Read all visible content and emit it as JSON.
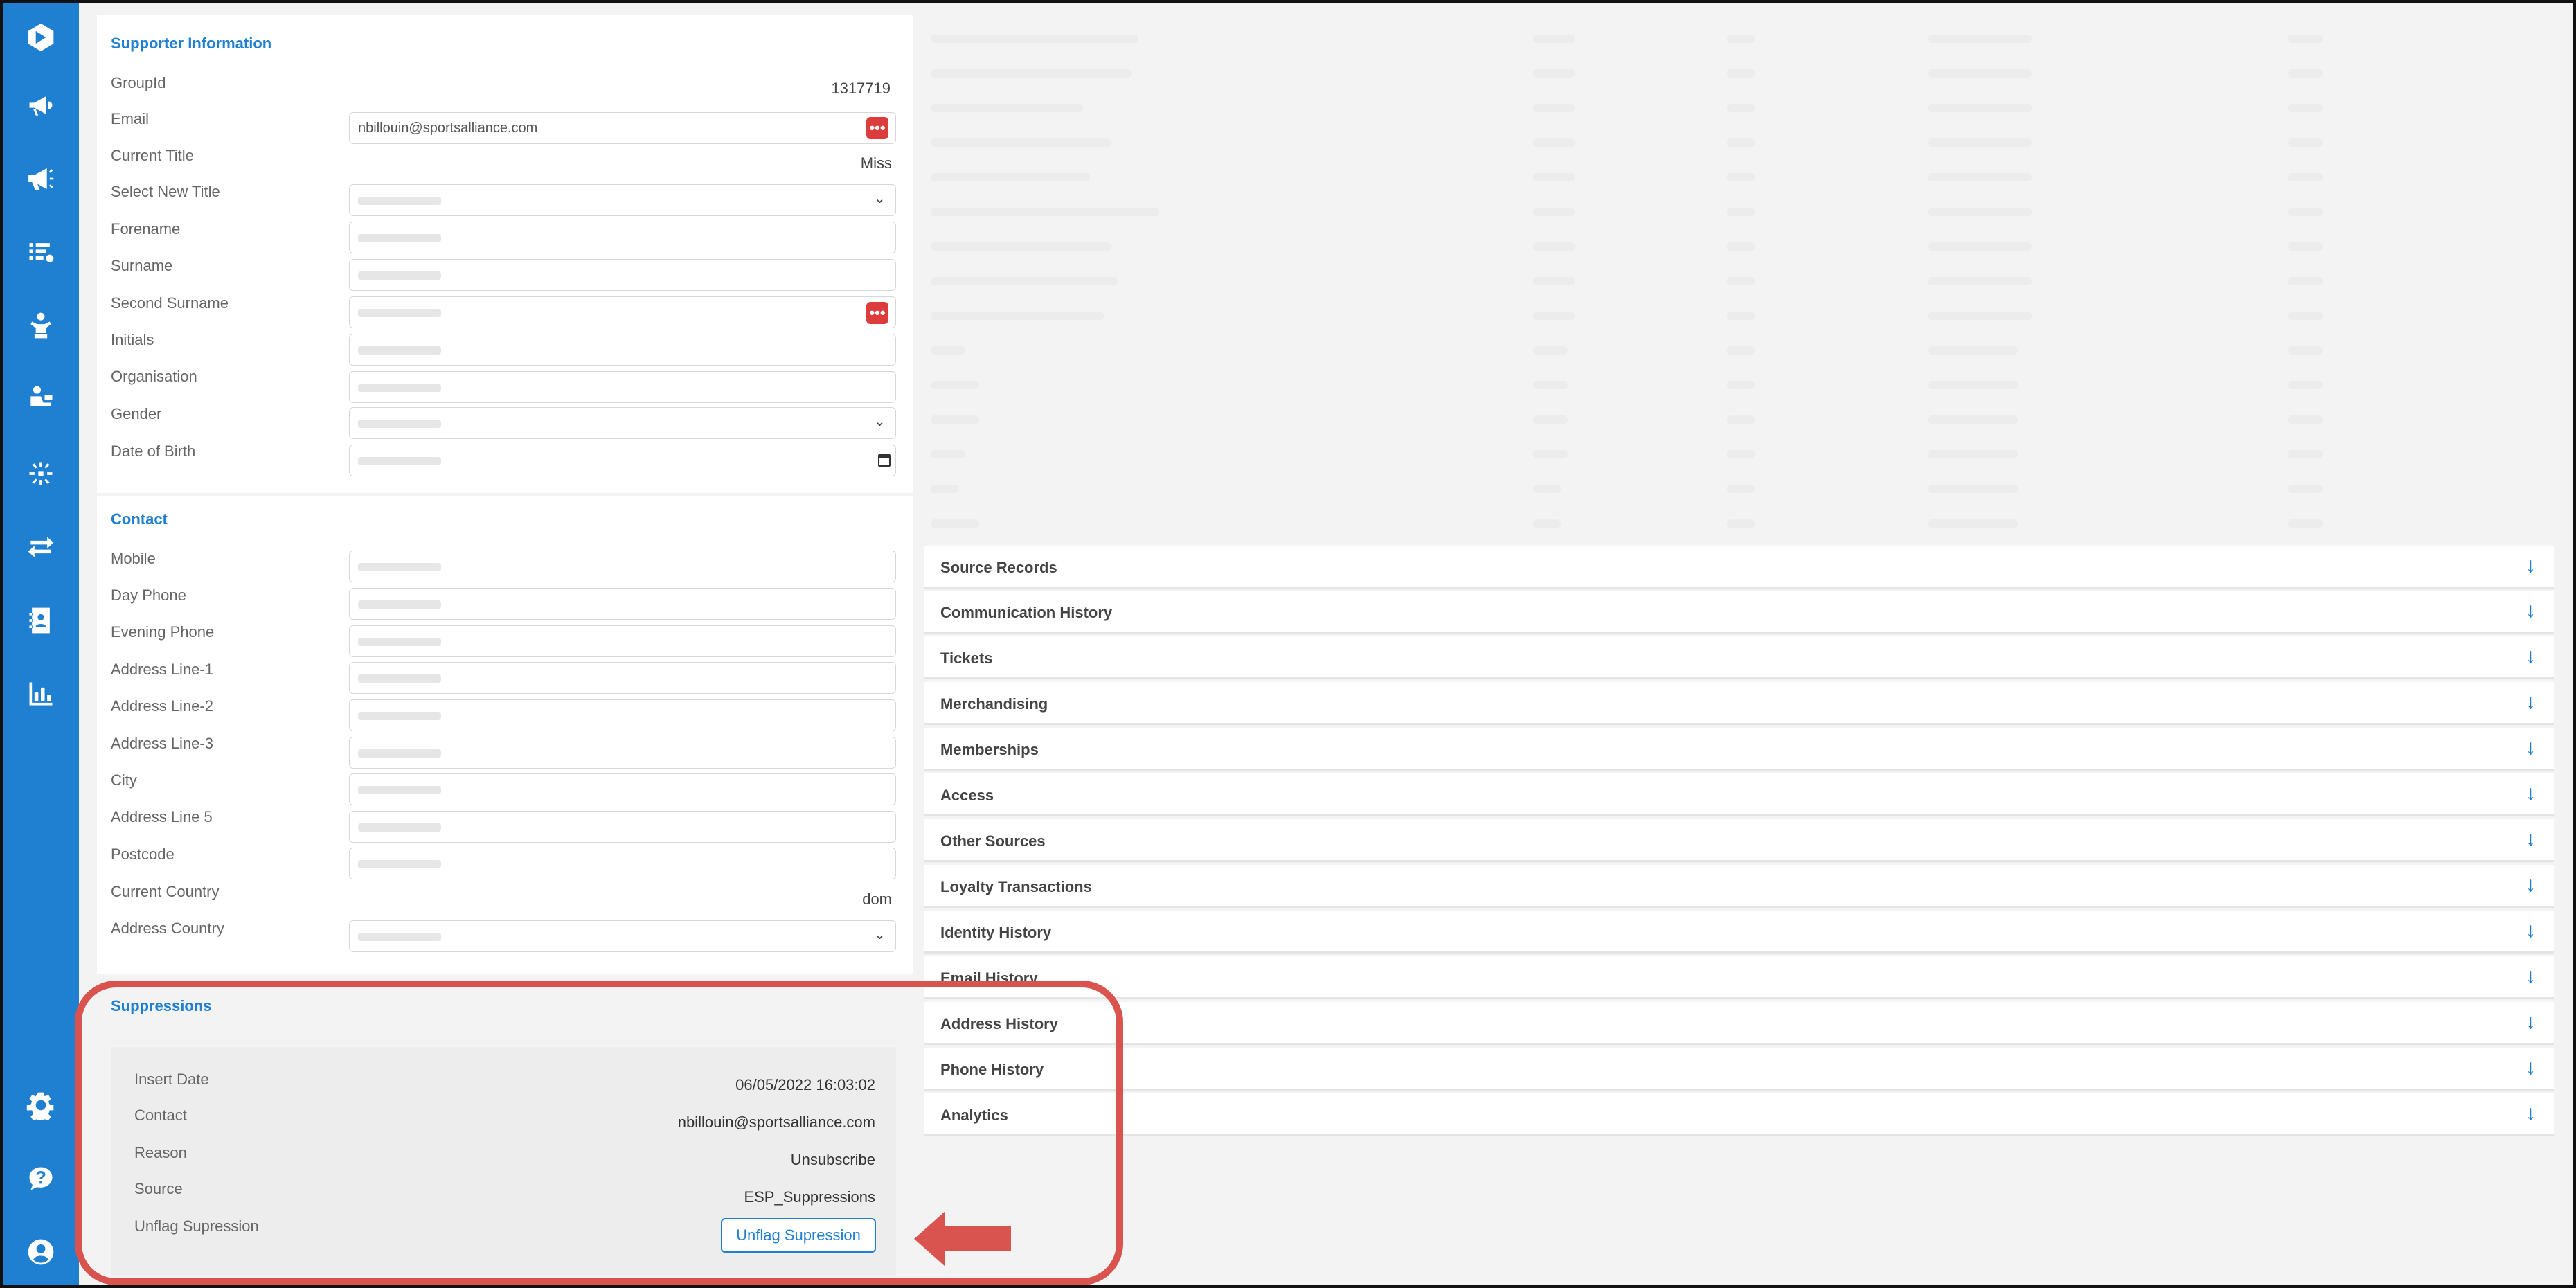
{
  "supporter": {
    "title": "Supporter Information",
    "group_id_label": "GroupId",
    "group_id_value": "1317719",
    "email_label": "Email",
    "email_value": "nbillouin@sportsalliance.com",
    "current_title_label": "Current Title",
    "current_title_value": "Miss",
    "select_title_label": "Select New Title",
    "forename_label": "Forename",
    "surname_label": "Surname",
    "second_surname_label": "Second Surname",
    "initials_label": "Initials",
    "organisation_label": "Organisation",
    "gender_label": "Gender",
    "dob_label": "Date of Birth"
  },
  "contact": {
    "title": "Contact",
    "mobile_label": "Mobile",
    "day_phone_label": "Day Phone",
    "evening_phone_label": "Evening Phone",
    "address1_label": "Address Line-1",
    "address2_label": "Address Line-2",
    "address3_label": "Address Line-3",
    "city_label": "City",
    "address5_label": "Address Line 5",
    "postcode_label": "Postcode",
    "current_country_label": "Current Country",
    "current_country_value": "dom",
    "address_country_label": "Address Country"
  },
  "suppressions": {
    "title": "Suppressions",
    "insert_date_label": "Insert Date",
    "insert_date_value": "06/05/2022 16:03:02",
    "contact_label": "Contact",
    "contact_value": "nbillouin@sportsalliance.com",
    "reason_label": "Reason",
    "reason_value": "Unsubscribe",
    "source_label": "Source",
    "source_value": "ESP_Suppressions",
    "unflag_label": "Unflag Supression",
    "unflag_button": "Unflag Supression"
  },
  "accordion": [
    {
      "label": "Source Records"
    },
    {
      "label": "Communication History"
    },
    {
      "label": "Tickets"
    },
    {
      "label": "Merchandising"
    },
    {
      "label": "Memberships"
    },
    {
      "label": "Access"
    },
    {
      "label": "Other Sources"
    },
    {
      "label": "Loyalty Transactions"
    },
    {
      "label": "Identity History"
    },
    {
      "label": "Email History"
    },
    {
      "label": "Address History"
    },
    {
      "label": "Phone History"
    },
    {
      "label": "Analytics"
    }
  ],
  "icons": {
    "dots": "•••",
    "chevron": "⌄",
    "down_arrow": "↓"
  },
  "colors": {
    "brand": "#1f7fd1",
    "highlight": "#d9534f",
    "action_red": "#dc3c3c"
  }
}
